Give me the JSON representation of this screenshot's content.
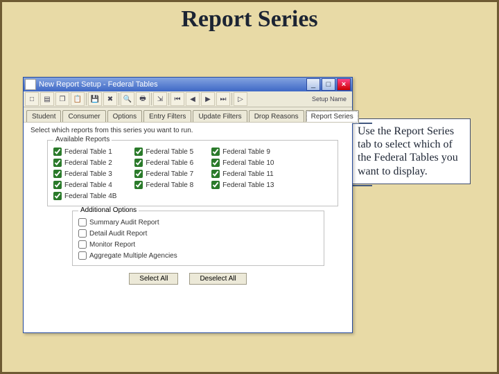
{
  "slide": {
    "title": "Report Series",
    "callout": "Use the Report Series tab to select which of the Federal Tables you want to display."
  },
  "window": {
    "title": "New Report Setup - Federal Tables",
    "title_icon": "report-icon",
    "buttons": {
      "min": "_",
      "max": "□",
      "close": "×"
    },
    "toolbar_setup_label": "Setup\nName"
  },
  "tabs": [
    "Student",
    "Consumer",
    "Options",
    "Entry Filters",
    "Update Filters",
    "Drop Reasons",
    "Report Series"
  ],
  "active_tab_index": 6,
  "body": {
    "instruction": "Select which reports from this series you want to run.",
    "available_legend": "Available Reports",
    "federal_tables": {
      "col1": [
        "Federal Table 1",
        "Federal Table 2",
        "Federal Table 3",
        "Federal Table 4",
        "Federal Table 4B"
      ],
      "col2": [
        "Federal Table 5",
        "Federal Table 6",
        "Federal Table 7",
        "Federal Table 8"
      ],
      "col3": [
        "Federal Table 9",
        "Federal Table 10",
        "Federal Table 11",
        "Federal Table 13"
      ]
    },
    "additional_legend": "Additional Options",
    "additional": [
      "Summary Audit Report",
      "Detail Audit Report",
      "Monitor Report",
      "Aggregate Multiple Agencies"
    ],
    "select_all": "Select All",
    "deselect_all": "Deselect All"
  }
}
